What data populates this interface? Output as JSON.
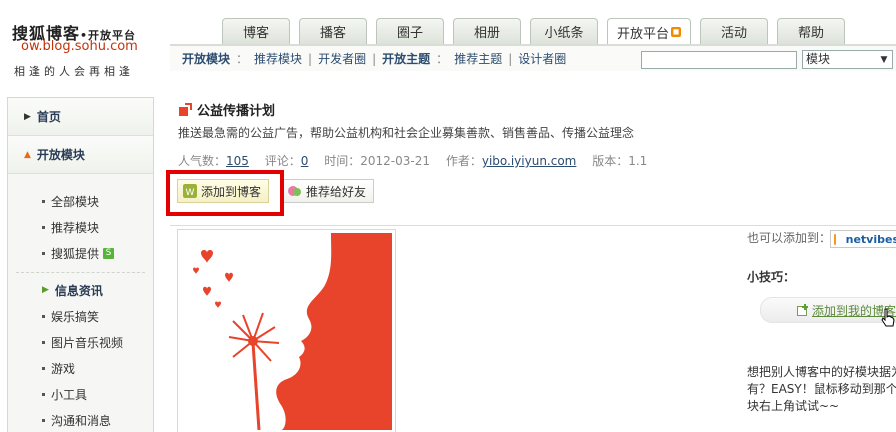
{
  "logo": {
    "title": "搜狐博客",
    "title_suffix": "•开放平台",
    "url": "ow.blog.sohu.com",
    "slogan": "相逢的人会再相逢"
  },
  "tabs": [
    {
      "label": "博客",
      "active": false
    },
    {
      "label": "播客",
      "active": false
    },
    {
      "label": "圈子",
      "active": false
    },
    {
      "label": "相册",
      "active": false
    },
    {
      "label": "小纸条",
      "active": false
    },
    {
      "label": "开放平台",
      "active": true
    },
    {
      "label": "活动",
      "active": false
    },
    {
      "label": "帮助",
      "active": false
    }
  ],
  "subnav": {
    "section1_label": "开放模块",
    "section1_links": [
      "推荐模块",
      "开发者圈"
    ],
    "section2_label": "开放主题",
    "section2_links": [
      "推荐主题",
      "设计者圈"
    ],
    "search_placeholder": "",
    "select_value": "模块"
  },
  "sidebar": {
    "home": "首页",
    "open_modules": "开放模块",
    "module_items": [
      "全部模块",
      "推荐模块",
      "搜狐提供"
    ],
    "sohu_badge": "S",
    "info_section": "信息资讯",
    "info_items": [
      "娱乐搞笑",
      "图片音乐视频",
      "游戏",
      "小工具",
      "沟通和消息"
    ]
  },
  "module": {
    "title": "公益传播计划",
    "description": "推送最急需的公益广告，帮助公益机构和社会企业募集善款、销售善品、传播公益理念",
    "popularity_label": "人气数：",
    "popularity": "105",
    "comments_label": "评论：",
    "comments": "0",
    "time_label": "时间：",
    "time": "2012-03-21",
    "author_label": "作者：",
    "author": "yibo.iyiyun.com",
    "version_label": "版本：",
    "version": "1.1",
    "add_button": "添加到博客",
    "recommend_button": "推荐给好友"
  },
  "right": {
    "also_add": "也可以添加到：",
    "netvibes": "netvibes",
    "tips_title": "小技巧：",
    "tip_button": "添加到我的博客",
    "tip_text": [
      "想把别人博客中的好模块据为己",
      "有？EASY！鼠标移动到那个模",
      "块右上角试试~~"
    ]
  },
  "colors": {
    "accent_red": "#e30000",
    "image_red": "#e8432b",
    "link_blue": "#2c4c70",
    "orange": "#e86b1a",
    "green": "#58b33a"
  }
}
